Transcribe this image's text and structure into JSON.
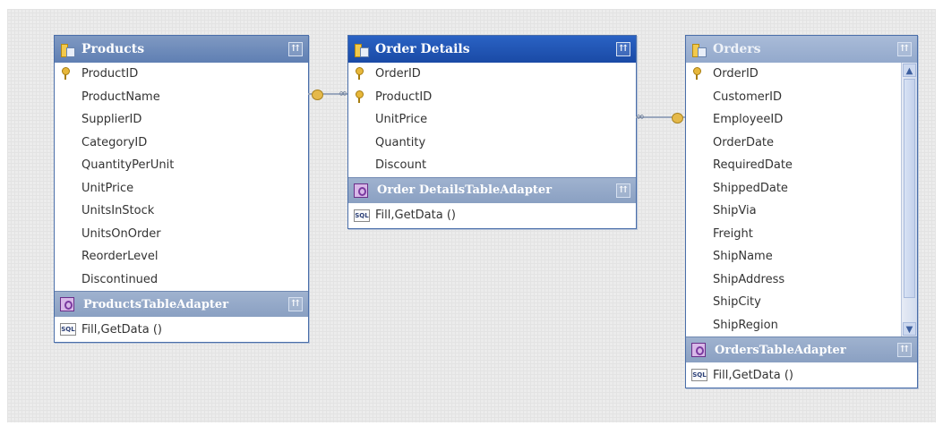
{
  "tables": [
    {
      "title": "Products",
      "columns": [
        {
          "name": "ProductID",
          "key": true
        },
        {
          "name": "ProductName",
          "key": false
        },
        {
          "name": "SupplierID",
          "key": false
        },
        {
          "name": "CategoryID",
          "key": false
        },
        {
          "name": "QuantityPerUnit",
          "key": false
        },
        {
          "name": "UnitPrice",
          "key": false
        },
        {
          "name": "UnitsInStock",
          "key": false
        },
        {
          "name": "UnitsOnOrder",
          "key": false
        },
        {
          "name": "ReorderLevel",
          "key": false
        },
        {
          "name": "Discontinued",
          "key": false
        }
      ],
      "adapter": {
        "title": "ProductsTableAdapter",
        "method": "Fill,GetData ()"
      }
    },
    {
      "title": "Order Details",
      "columns": [
        {
          "name": "OrderID",
          "key": true
        },
        {
          "name": "ProductID",
          "key": true
        },
        {
          "name": "UnitPrice",
          "key": false
        },
        {
          "name": "Quantity",
          "key": false
        },
        {
          "name": "Discount",
          "key": false
        }
      ],
      "adapter": {
        "title": "Order DetailsTableAdapter",
        "method": "Fill,GetData ()"
      }
    },
    {
      "title": "Orders",
      "columns": [
        {
          "name": "OrderID",
          "key": true
        },
        {
          "name": "CustomerID",
          "key": false
        },
        {
          "name": "EmployeeID",
          "key": false
        },
        {
          "name": "OrderDate",
          "key": false
        },
        {
          "name": "RequiredDate",
          "key": false
        },
        {
          "name": "ShippedDate",
          "key": false
        },
        {
          "name": "ShipVia",
          "key": false
        },
        {
          "name": "Freight",
          "key": false
        },
        {
          "name": "ShipName",
          "key": false
        },
        {
          "name": "ShipAddress",
          "key": false
        },
        {
          "name": "ShipCity",
          "key": false
        },
        {
          "name": "ShipRegion",
          "key": false
        }
      ],
      "adapter": {
        "title": "OrdersTableAdapter",
        "method": "Fill,GetData ()"
      }
    }
  ],
  "icons": {
    "collapse": "⇈",
    "scroll_up": "▲",
    "scroll_down": "▼",
    "sql": "SQL"
  }
}
